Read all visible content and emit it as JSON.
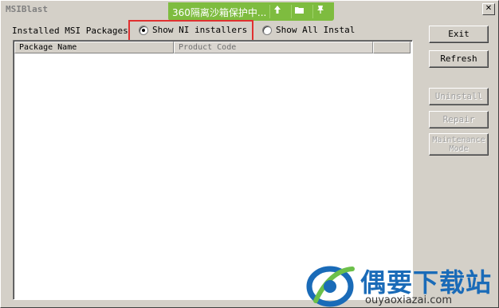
{
  "window": {
    "title": "MSIBlast",
    "close_glyph": "✕"
  },
  "sandbox_bar": {
    "text": "360隔离沙箱保护中...",
    "icons": [
      "tree-icon",
      "folder-icon",
      "pin-icon"
    ]
  },
  "main": {
    "packages_label": "Installed MSI Packages",
    "radio_ni": "Show NI installers",
    "radio_all": "Show All Instal",
    "selected": "Show NI installers"
  },
  "list": {
    "columns": [
      "Package Name",
      "Product Code",
      ""
    ],
    "rows": []
  },
  "buttons": {
    "exit": "Exit",
    "refresh": "Refresh",
    "uninstall": "Uninstall",
    "repair": "Repair",
    "maintenance": "Maintenance Mode"
  },
  "watermark": {
    "chinese": "偶要下载站",
    "url": "ouyaoxiazai.com"
  },
  "colors": {
    "sandbox_green": "#7ebc3f",
    "highlight_red": "#e03030",
    "watermark_blue": "#1a6bb8",
    "face": "#d4d0c8"
  }
}
